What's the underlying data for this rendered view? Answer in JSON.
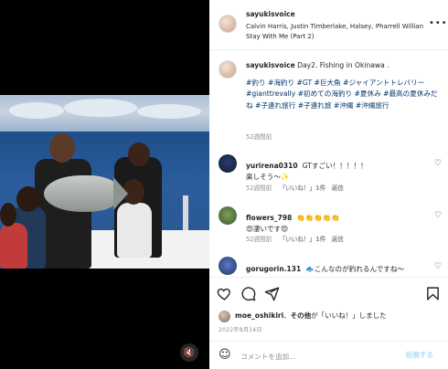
{
  "post": {
    "username": "sayukisvoice",
    "music": "Calvin Harris, Justin Timberlake, Halsey, Pharrell Willian",
    "music_line2": "Stay With Me (Part 2)",
    "more_icon": "more-icon"
  },
  "caption": {
    "username": "sayukisvoice",
    "text": "Day2. Fishing in Okinawa .",
    "tags": "#釣り #海釣り #GT #巨大魚 #ジャイアントトレバリー #gianttrevally #初めての海釣り #夏休み #最高の夏休みだね #子連れ旅行 #子連れ旅 #沖縄 #沖縄旅行",
    "time": "52週間前"
  },
  "comments": [
    {
      "username": "yurirena0310",
      "text": "GTすごい！！！！！",
      "text2": "楽しそう〜✨",
      "time": "52週間前",
      "likes": "「いいね！」1件",
      "reply": "返信"
    },
    {
      "username": "flowers_798",
      "text": "👏👏👏👏👏",
      "text2": "😍凄いです😍",
      "time": "52週間前",
      "likes": "「いいね！」1件",
      "reply": "返信"
    },
    {
      "username": "gorugorin.131",
      "text": "🐟こんなのが釣れるんですね〜",
      "text2": "😲"
    }
  ],
  "actions": {
    "liked_by_user": "moe_oshikiri",
    "liked_by_mid": "、",
    "liked_by_others": "その他",
    "liked_by_tail": "が「いいね！」しました",
    "date": "2022年8月14日",
    "comment_placeholder": "コメントを追加...",
    "post_label": "投稿する"
  },
  "colors": {
    "link": "#00376b",
    "muted": "#8e8e8e",
    "post_disabled": "#b2dffc"
  }
}
